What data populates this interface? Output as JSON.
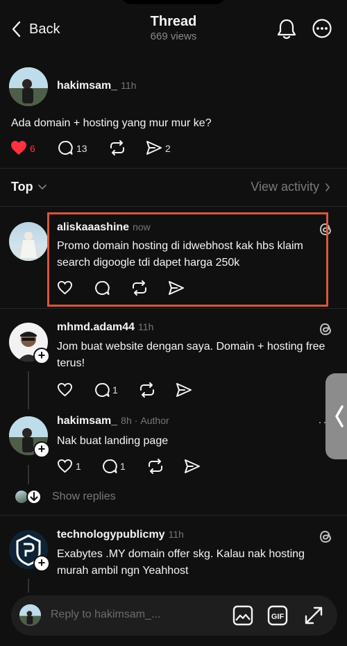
{
  "header": {
    "back_label": "Back",
    "title": "Thread",
    "views": "669 views"
  },
  "original_post": {
    "username": "hakimsam_",
    "time": "11h",
    "text": "Ada domain + hosting yang mur mur ke?",
    "likes": "6",
    "replies": "13",
    "shares": "2"
  },
  "filter": {
    "sort_label": "Top",
    "activity_label": "View activity"
  },
  "replies": [
    {
      "username": "aliskaaashine",
      "time": "now",
      "text": "Promo domain hosting di idwebhost kak hbs klaim search digoogle tdi dapet harga 250k"
    },
    {
      "username": "mhmd.adam44",
      "time": "11h",
      "text": "Jom buat website dengan saya. Domain + hosting free terus!",
      "reply_count": "1"
    },
    {
      "username": "hakimsam_",
      "time": "8h",
      "author_label": "Author",
      "text": "Nak buat landing page",
      "like_count": "1",
      "reply_count": "1"
    },
    {
      "username": "technologypublicmy",
      "time": "11h",
      "text": "Exabytes .MY domain offer skg. Kalau nak hosting murah ambil ngn Yeahhost"
    }
  ],
  "show_replies_label": "Show replies",
  "reply_input": {
    "placeholder": "Reply to hakimsam_..."
  },
  "icons": [
    "back-chevron-icon",
    "bell-icon",
    "more-icon",
    "heart-icon",
    "comment-icon",
    "repost-icon",
    "send-icon",
    "threads-logo-icon",
    "image-icon",
    "gif-icon",
    "expand-icon"
  ],
  "colors": {
    "background": "#101010",
    "liked_heart": "#ff3040",
    "highlight_box": "#d9563f"
  }
}
